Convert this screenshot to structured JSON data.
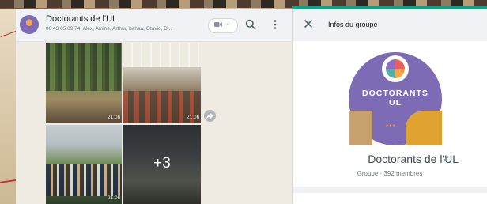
{
  "chat": {
    "title": "Doctorants de l'UL",
    "subtitle": "06 43 05 09 74, Alex, Amine, Arthur, bahaa, Otávio, D...",
    "media": {
      "times": [
        "21:06",
        "21:06",
        "21:06"
      ],
      "more_count": "+3"
    }
  },
  "info": {
    "header_title": "Infos du groupe",
    "avatar_line1": "DOCTORANTS",
    "avatar_line2": "UL",
    "group_name": "Doctorants de l'UL",
    "group_meta": "Groupe · 392 membres"
  },
  "colors": {
    "accent": "#00a884",
    "avatar_bg": "#7d6cb5",
    "chat_bg": "#efeae2",
    "header_bg": "#f0f2f5"
  },
  "icons": [
    "video-call-icon",
    "chevron-down-icon",
    "search-icon",
    "menu-icon",
    "forward-icon",
    "close-icon",
    "edit-icon"
  ]
}
